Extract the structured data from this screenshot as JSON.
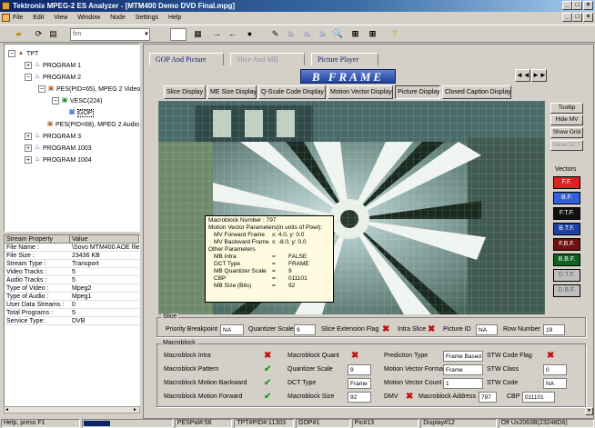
{
  "window": {
    "title": "Tektronix MPEG-2 ES Analyzer - [MTM400 Demo DVD Final.mpg]"
  },
  "menu": [
    "File",
    "Edit",
    "View",
    "Window",
    "Node",
    "Settings",
    "Help"
  ],
  "toolbar": {
    "combo_value": "fim"
  },
  "tree": {
    "root": "TPT",
    "nodes": [
      {
        "label": "PROGRAM 1",
        "level": 1,
        "exp": "+"
      },
      {
        "label": "PROGRAM 2",
        "level": 1,
        "exp": "-"
      },
      {
        "label": "PES(PID=65), MPEG 2 Video",
        "level": 2,
        "exp": "-"
      },
      {
        "label": "VESC(224)",
        "level": 3,
        "exp": "-"
      },
      {
        "label": "GOP",
        "level": 4,
        "exp": ""
      },
      {
        "label": "PES(PID=68), MPEG 2 Audio",
        "level": 2,
        "exp": ""
      },
      {
        "label": "PROGRAM 3",
        "level": 1,
        "exp": "+"
      },
      {
        "label": "PROGRAM 1003",
        "level": 1,
        "exp": "+"
      },
      {
        "label": "PROGRAM 1004",
        "level": 1,
        "exp": "+"
      }
    ]
  },
  "props": {
    "headers": [
      "Stream Property",
      "Value"
    ],
    "rows": [
      [
        "File Name :",
        "\\Sovo MTM400 AOE file"
      ],
      [
        "File Size :",
        "23436 KB"
      ],
      [
        "Stream Type :",
        "Transport"
      ],
      [
        "Video Tracks :",
        "5"
      ],
      [
        "Audio Tracks :",
        "5"
      ],
      [
        "Type of Video :",
        "Mpeg2"
      ],
      [
        "Type of Audio :",
        "Mpeg1"
      ],
      [
        "User Data Streams :",
        "0"
      ],
      [
        "Total Programs :",
        "5"
      ],
      [
        "Service Type:",
        "DVB"
      ]
    ]
  },
  "tabs": [
    "GOP And Picture",
    "Slice And MB",
    "Picture Player"
  ],
  "frame_label": "B FRAME",
  "nav": {
    "prev": "◄◄",
    "next": "►►"
  },
  "display_tabs": [
    "Slice Display",
    "ME Size Display",
    "Q-Scale Code Display",
    "Motion Vector Display",
    "Picture Display",
    "Closed Caption Display"
  ],
  "side_buttons": [
    "Tooltip",
    "Hide MV",
    "Show Grid",
    "Show DCT"
  ],
  "vectors": {
    "label": "Vectors",
    "items": [
      {
        "name": "F.F.",
        "color": "#e02020"
      },
      {
        "name": "B.F.",
        "color": "#3060e0"
      },
      {
        "name": "F.T.F.",
        "color": "#101010"
      },
      {
        "name": "B.T.F.",
        "color": "#2040a0"
      },
      {
        "name": "F.B.F.",
        "color": "#701010"
      },
      {
        "name": "B.B.F.",
        "color": "#106020"
      },
      {
        "name": "D.T.F.",
        "color": "#c0c0c0"
      },
      {
        "name": "D.B.F.",
        "color": "#c0c0c0"
      }
    ]
  },
  "mbinfo": {
    "title": "Macroblock Number : 797",
    "mv_title": "Motion Vector Parameters(in units of Pixel):",
    "mv": [
      {
        "k": "MV Forward Frame",
        "v": "x: 4.0, y: 0.0"
      },
      {
        "k": "MV Backward Frame",
        "v": "x: -8.0, y: 0.0"
      }
    ],
    "other_title": "Other Parameters",
    "other": [
      {
        "k": "MB Intra",
        "v": "FALSE"
      },
      {
        "k": "DCT Type",
        "v": "FRAME"
      },
      {
        "k": "MB Quantizer Scale",
        "v": "9"
      },
      {
        "k": "CBP",
        "v": "011101"
      },
      {
        "k": "MB Size (Bits)",
        "v": "92"
      }
    ]
  },
  "slice": {
    "legend": "Slice",
    "priority_label": "Priority Breakpoint",
    "priority": "NA",
    "qscale_label": "Quantizer Scale",
    "qscale": "9",
    "ext_label": "Slice Extension Flag",
    "intra_label": "Intra Slice",
    "picid_label": "Picture ID",
    "picid": "NA",
    "row_label": "Row Number",
    "row": "19"
  },
  "macroblock": {
    "legend": "Macroblock",
    "col1": [
      {
        "k": "Macroblock Intra",
        "s": "x"
      },
      {
        "k": "Macroblock Pattern",
        "s": "v"
      },
      {
        "k": "Macroblock Motion Backward",
        "s": "v"
      },
      {
        "k": "Macroblock Motion Forward",
        "s": "v"
      }
    ],
    "col2": [
      {
        "k": "Macroblock Quant",
        "s": "x"
      },
      {
        "k": "Quantizer Scale",
        "v": "9"
      },
      {
        "k": "DCT Type",
        "v": "Frame"
      },
      {
        "k": "Macroblock Size",
        "v": "92"
      }
    ],
    "col3": [
      {
        "k": "Prediction Type",
        "v": "Frame Based"
      },
      {
        "k": "Motion Vector Format",
        "v": "Frame"
      },
      {
        "k": "Motion Vector Count",
        "v": "1"
      },
      {
        "k": "DMV",
        "s": "x"
      }
    ],
    "col4": [
      {
        "k": "STW Code Flag",
        "s": "x"
      },
      {
        "k": "STW Class",
        "v": "0"
      },
      {
        "k": "STW Code",
        "v": "NA"
      }
    ],
    "addr_label": "Macroblock Address",
    "addr": "797",
    "cbp_label": "CBP",
    "cbp": "011101"
  },
  "status": [
    "Help, press F1",
    "",
    "PESPid#:56",
    "TPT#PID#:11303",
    "GOP#1",
    "Pic#13",
    "Display#12",
    "Off Ux2063B(23248D6)"
  ]
}
